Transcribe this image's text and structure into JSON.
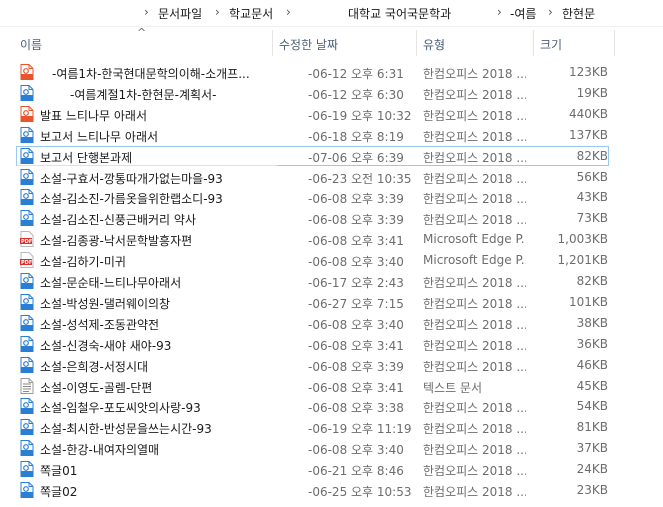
{
  "breadcrumb": {
    "items": [
      "문서파일",
      "학교문서",
      "대학교 국어국문학과",
      "-여름",
      "한현문"
    ],
    "separator": "›"
  },
  "columns": {
    "name": "이름",
    "modified": "수정한 날짜",
    "type": "유형",
    "size": "크기"
  },
  "files": [
    {
      "name": "-여름1차-한국현대문학의이해-소개프...",
      "date": "-06-12 오후 6:31",
      "type": "한컴오피스 2018 ...",
      "size": "123KB",
      "icon": "hwp-show-icon"
    },
    {
      "name": "-여름계절1차-한현문-계획서-",
      "date": "-06-12 오후 6:30",
      "type": "한컴오피스 2018 ...",
      "size": "19KB",
      "icon": "hwp-doc-icon"
    },
    {
      "name": "발표 느티나무 아래서",
      "date": "-06-19 오후 10:32",
      "type": "한컴오피스 2018 ...",
      "size": "440KB",
      "icon": "hwp-show-icon"
    },
    {
      "name": "보고서 느티나무 아래서",
      "date": "-06-18 오후 8:19",
      "type": "한컴오피스 2018 ...",
      "size": "137KB",
      "icon": "hwp-doc-icon"
    },
    {
      "name": "보고서 단행본과제",
      "date": "-07-06 오후 6:39",
      "type": "한컴오피스 2018 ...",
      "size": "82KB",
      "icon": "hwp-doc-icon"
    },
    {
      "name": "소설-구효서-깡통따개가없는마을-93",
      "date": "-06-23 오전 10:35",
      "type": "한컴오피스 2018 ...",
      "size": "56KB",
      "icon": "hwp-doc-icon"
    },
    {
      "name": "소설-김소진-가름옷을위한랩소디-93",
      "date": "-06-08 오후 3:39",
      "type": "한컴오피스 2018 ...",
      "size": "43KB",
      "icon": "hwp-doc-icon"
    },
    {
      "name": "소설-김소진-신풍근배커리 약사",
      "date": "-06-08 오후 3:39",
      "type": "한컴오피스 2018 ...",
      "size": "73KB",
      "icon": "hwp-doc-icon"
    },
    {
      "name": "소설-김종광-낙서문학발흥자편",
      "date": "-06-08 오후 3:41",
      "type": "Microsoft Edge P...",
      "size": "1,003KB",
      "icon": "pdf-icon"
    },
    {
      "name": "소설-김하기-미귀",
      "date": "-06-08 오후 3:40",
      "type": "Microsoft Edge P...",
      "size": "1,201KB",
      "icon": "pdf-icon"
    },
    {
      "name": "소설-문순태-느티나무아래서",
      "date": "-06-17 오후 2:43",
      "type": "한컴오피스 2018 ...",
      "size": "82KB",
      "icon": "hwp-doc-icon"
    },
    {
      "name": "소설-박성원-댈러웨이의창",
      "date": "-06-27 오후 7:15",
      "type": "한컴오피스 2018 ...",
      "size": "101KB",
      "icon": "hwp-doc-icon"
    },
    {
      "name": "소설-성석제-조동관약전",
      "date": "-06-08 오후 3:40",
      "type": "한컴오피스 2018 ...",
      "size": "38KB",
      "icon": "hwp-doc-icon"
    },
    {
      "name": "소설-신경숙-새야 새야-93",
      "date": "-06-08 오후 3:41",
      "type": "한컴오피스 2018 ...",
      "size": "36KB",
      "icon": "hwp-doc-icon"
    },
    {
      "name": "소설-은희경-서정시대",
      "date": "-06-08 오후 3:39",
      "type": "한컴오피스 2018 ...",
      "size": "46KB",
      "icon": "hwp-doc-icon"
    },
    {
      "name": "소설-이영도-골렘-단편",
      "date": "-06-08 오후 3:41",
      "type": "텍스트 문서",
      "size": "45KB",
      "icon": "text-file-icon"
    },
    {
      "name": "소설-임철우-포도씨앗의사랑-93",
      "date": "-06-08 오후 3:38",
      "type": "한컴오피스 2018 ...",
      "size": "54KB",
      "icon": "hwp-doc-icon"
    },
    {
      "name": "소설-최시한-반성문을쓰는시간-93",
      "date": "-06-19 오후 11:19",
      "type": "한컴오피스 2018 ...",
      "size": "81KB",
      "icon": "hwp-doc-icon"
    },
    {
      "name": "소설-한강-내여자의열매",
      "date": "-06-08 오후 3:40",
      "type": "한컴오피스 2018 ...",
      "size": "37KB",
      "icon": "hwp-doc-icon"
    },
    {
      "name": "쪽글01",
      "date": "-06-21 오후 8:46",
      "type": "한컴오피스 2018 ...",
      "size": "24KB",
      "icon": "hwp-doc-icon"
    },
    {
      "name": "쪽글02",
      "date": "-06-25 오후 10:53",
      "type": "한컴오피스 2018 ...",
      "size": "23KB",
      "icon": "hwp-doc-icon"
    }
  ],
  "colors": {
    "hwp_blue": "#2a7fd4",
    "hwp_orange": "#e8542b",
    "pdf_red": "#d9302c",
    "focus_border": "#99c9ef",
    "header_text": "#4c607a"
  }
}
